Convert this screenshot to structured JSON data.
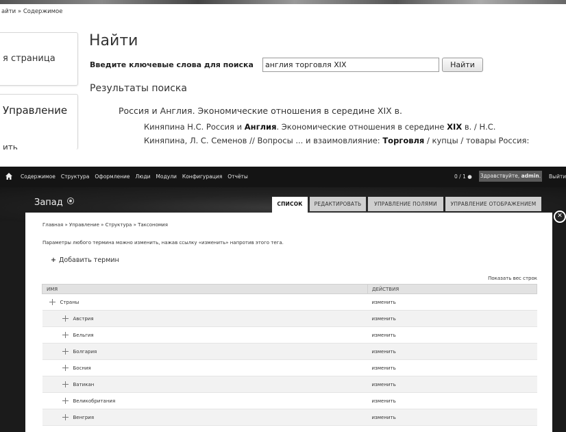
{
  "search_page": {
    "breadcrumb": "айти » Содержимое",
    "side_card_1": "я страница",
    "side_card_2_title": "Управление",
    "side_card_2_bottom": "ить",
    "heading": "Найти",
    "search_label": "Введите ключевые слова для поиска",
    "search_value": "англия торговля XIX",
    "search_button": "Найти",
    "results_heading": "Результаты поиска",
    "result_title": "Россия и Англия. Экономические отношения в середине XIX в.",
    "snippet_1": {
      "a": "Киняпина Н.С. Россия и ",
      "b": "Англия",
      "c": ". Экономические отношения в середине ",
      "d": "XIX",
      "e": " в. / Н.С."
    },
    "snippet_2": {
      "a": "Киняпина, Л. С. Семенов // Вопросы ... и взаимовлияние: ",
      "b": "Торговля",
      "c": " / купцы / товары Россия:"
    }
  },
  "admin": {
    "toolbar": {
      "menu": [
        "Содержимое",
        "Структура",
        "Оформление",
        "Люди",
        "Модули",
        "Конфигурация",
        "Отчёты"
      ],
      "counter": "0 / 1",
      "greeting": "Здравствуйте, ",
      "user": "admin",
      "logout": "Выйти"
    },
    "region": "Запад",
    "tabs": [
      "СПИСОК",
      "РЕДАКТИРОВАТЬ",
      "УПРАВЛЕНИЕ ПОЛЯМИ",
      "УПРАВЛЕНИЕ ОТОБРАЖЕНИЕМ"
    ],
    "breadcrumb": "Главная » Управление » Структура » Таксономия",
    "help": "Параметры любого термина можно изменить, нажав ссылку «изменить» напротив этого тега.",
    "add_term": "Добавить термин",
    "show_weights": "Показать вес строк",
    "table": {
      "col_name": "ИМЯ",
      "col_actions": "ДЕЙСТВИЯ",
      "rows": [
        {
          "name": "Страны",
          "action": "изменить"
        },
        {
          "name": "Австрия",
          "action": "изменить"
        },
        {
          "name": "Бельгия",
          "action": "изменить"
        },
        {
          "name": "Болгария",
          "action": "изменить"
        },
        {
          "name": "Босния",
          "action": "изменить"
        },
        {
          "name": "Ватикан",
          "action": "изменить"
        },
        {
          "name": "Великобритания",
          "action": "изменить"
        },
        {
          "name": "Венгрия",
          "action": "изменить"
        }
      ]
    }
  }
}
